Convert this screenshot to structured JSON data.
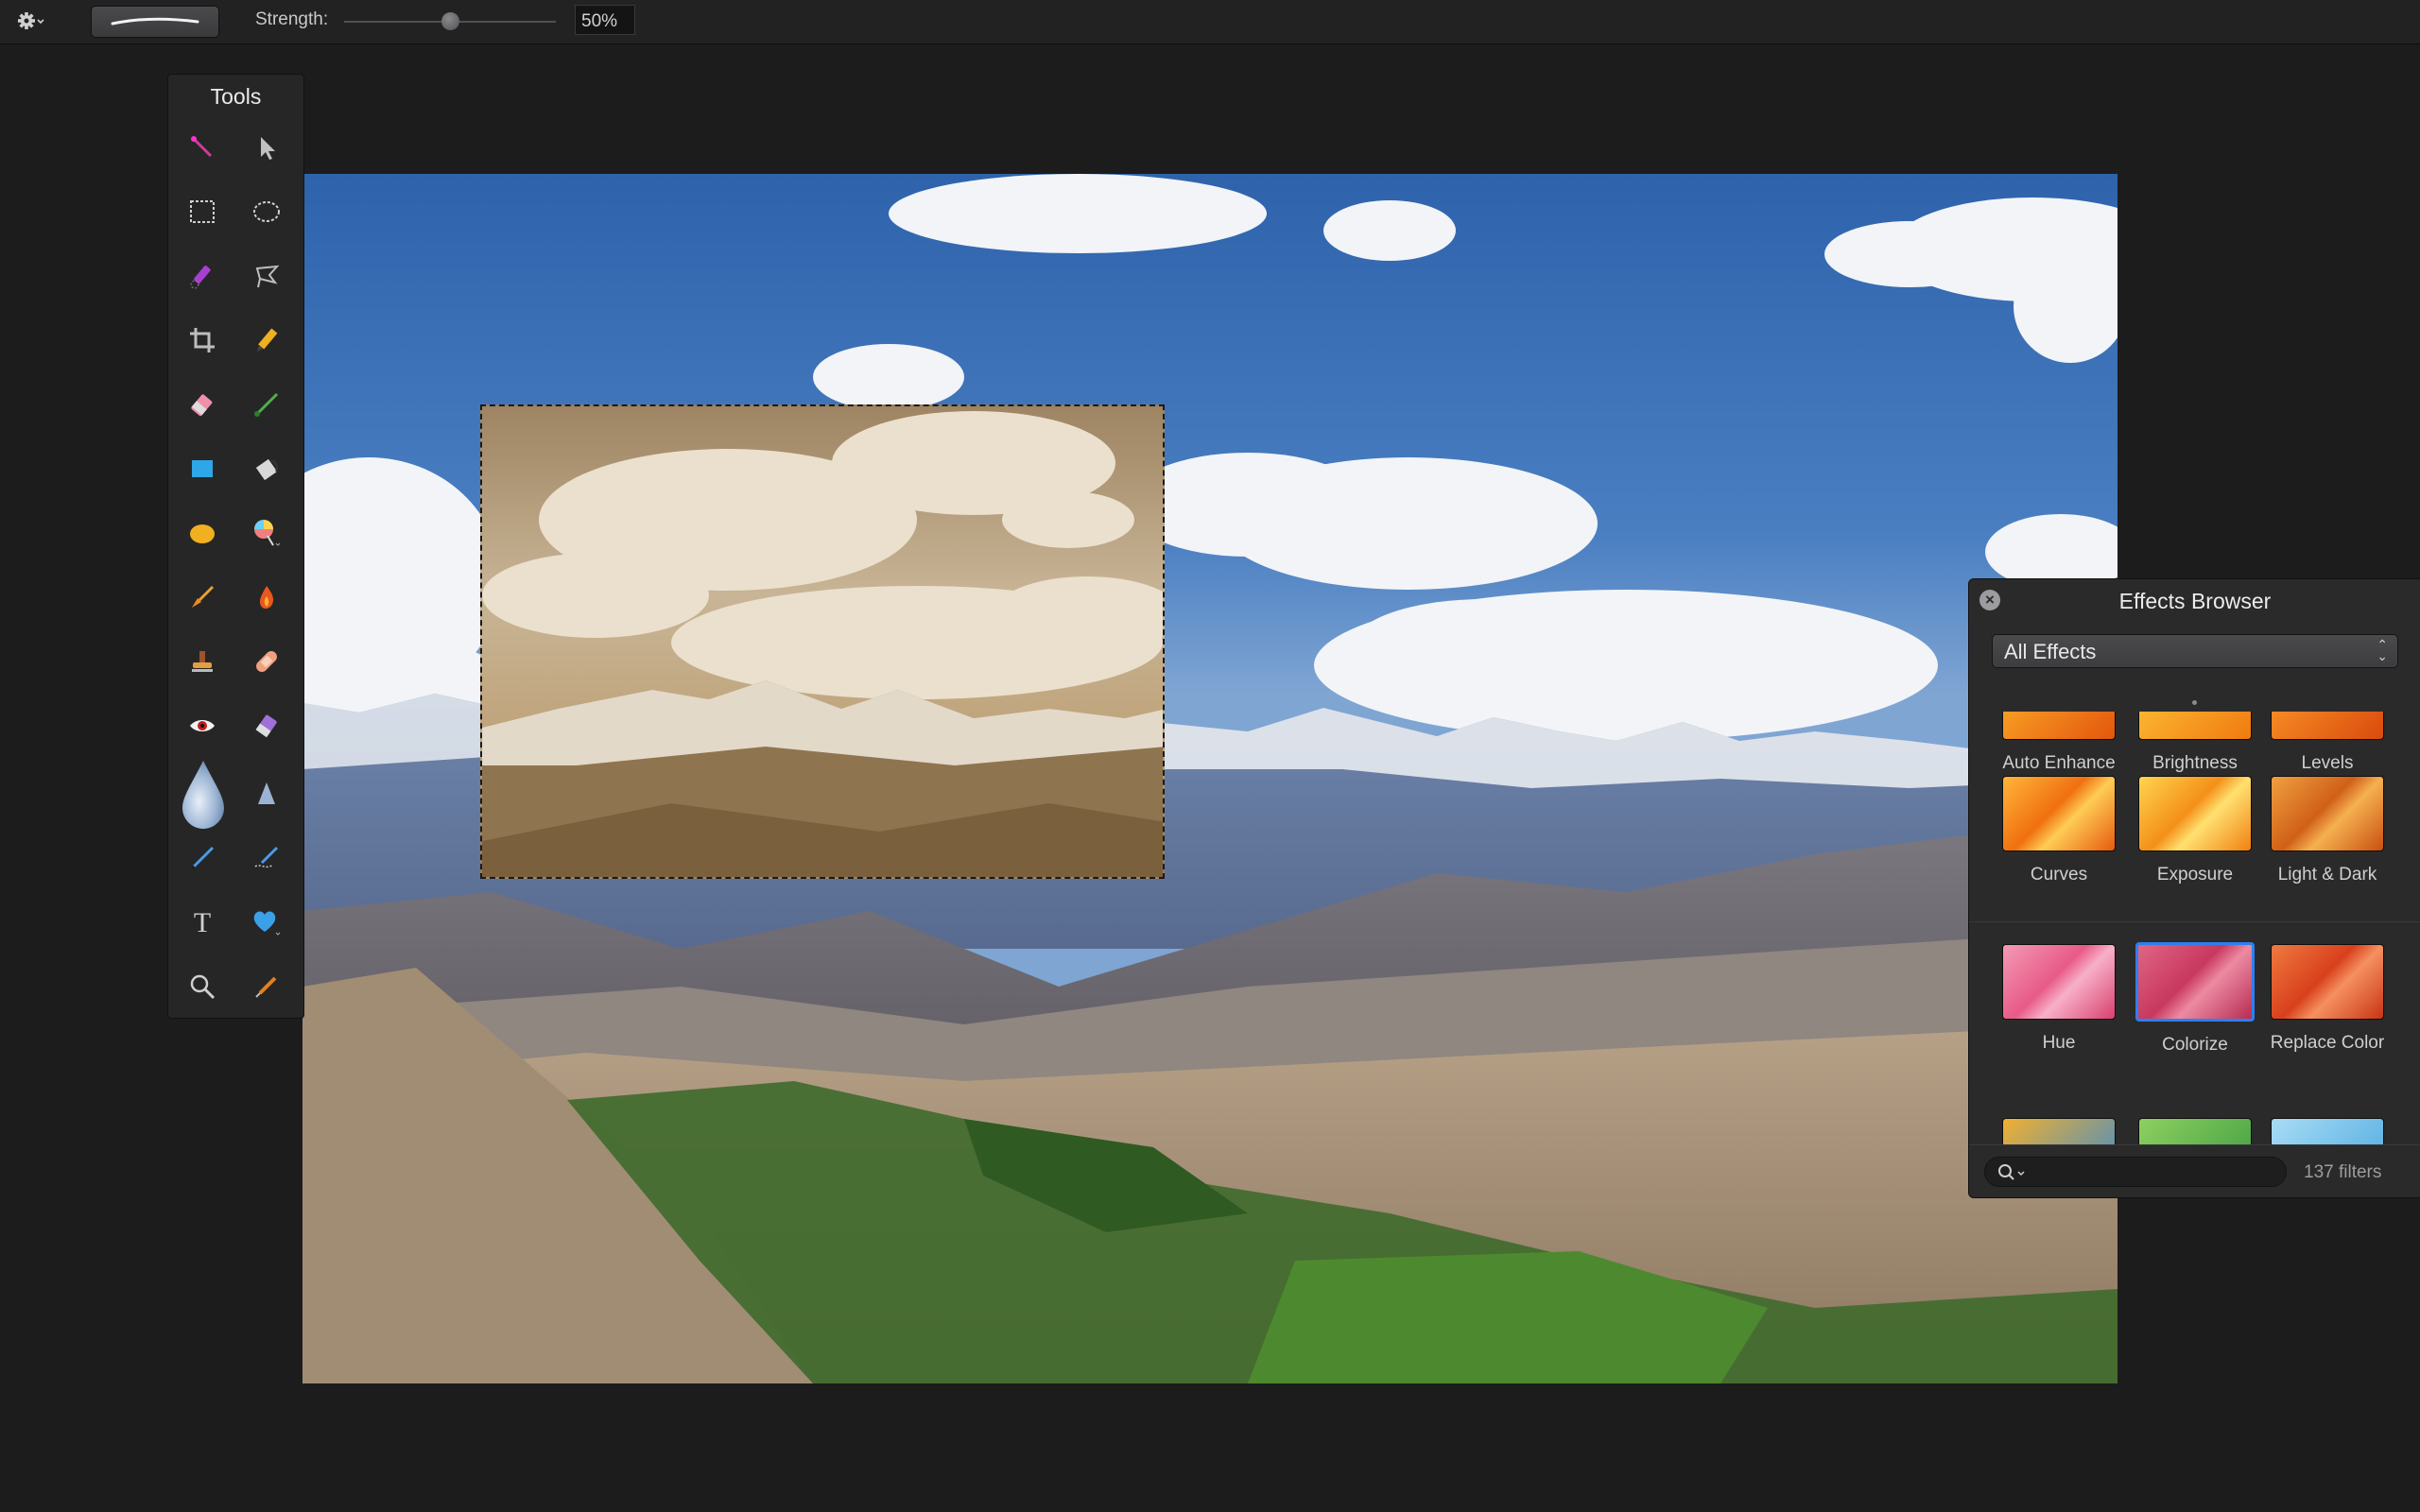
{
  "toolbar": {
    "gear_icon": "gear-icon",
    "strength_label": "Strength:",
    "strength_value": "50%",
    "strength_level": 0.5
  },
  "tools": {
    "title": "Tools",
    "items": [
      "magic-wand-icon",
      "arrow-icon",
      "rect-select-icon",
      "ellipse-select-icon",
      "quick-select-icon",
      "lasso-icon",
      "crop-icon",
      "pencil-icon",
      "eraser-icon",
      "brush-icon",
      "rectangle-shape-icon",
      "paint-bucket-icon",
      "ellipse-shape-icon",
      "lollipop-icon",
      "smudge-icon",
      "burn-icon",
      "stamp-icon",
      "bandage-icon",
      "red-eye-icon",
      "sponge-icon",
      "blur-drop-icon",
      "sharpen-cone-icon",
      "pen-icon",
      "freeform-pen-icon",
      "text-icon",
      "heart-icon",
      "zoom-icon",
      "eyedropper-icon"
    ]
  },
  "effects_browser": {
    "title": "Effects Browser",
    "filter_select": "All Effects",
    "row1": [
      "Auto Enhance",
      "Brightness",
      "Levels"
    ],
    "row2": [
      "Curves",
      "Exposure",
      "Light & Dark"
    ],
    "row3": [
      "Hue",
      "Colorize",
      "Replace Color"
    ],
    "selected": "Colorize",
    "count": "137 filters",
    "colors": {
      "accent": "#2f7ff0"
    }
  }
}
